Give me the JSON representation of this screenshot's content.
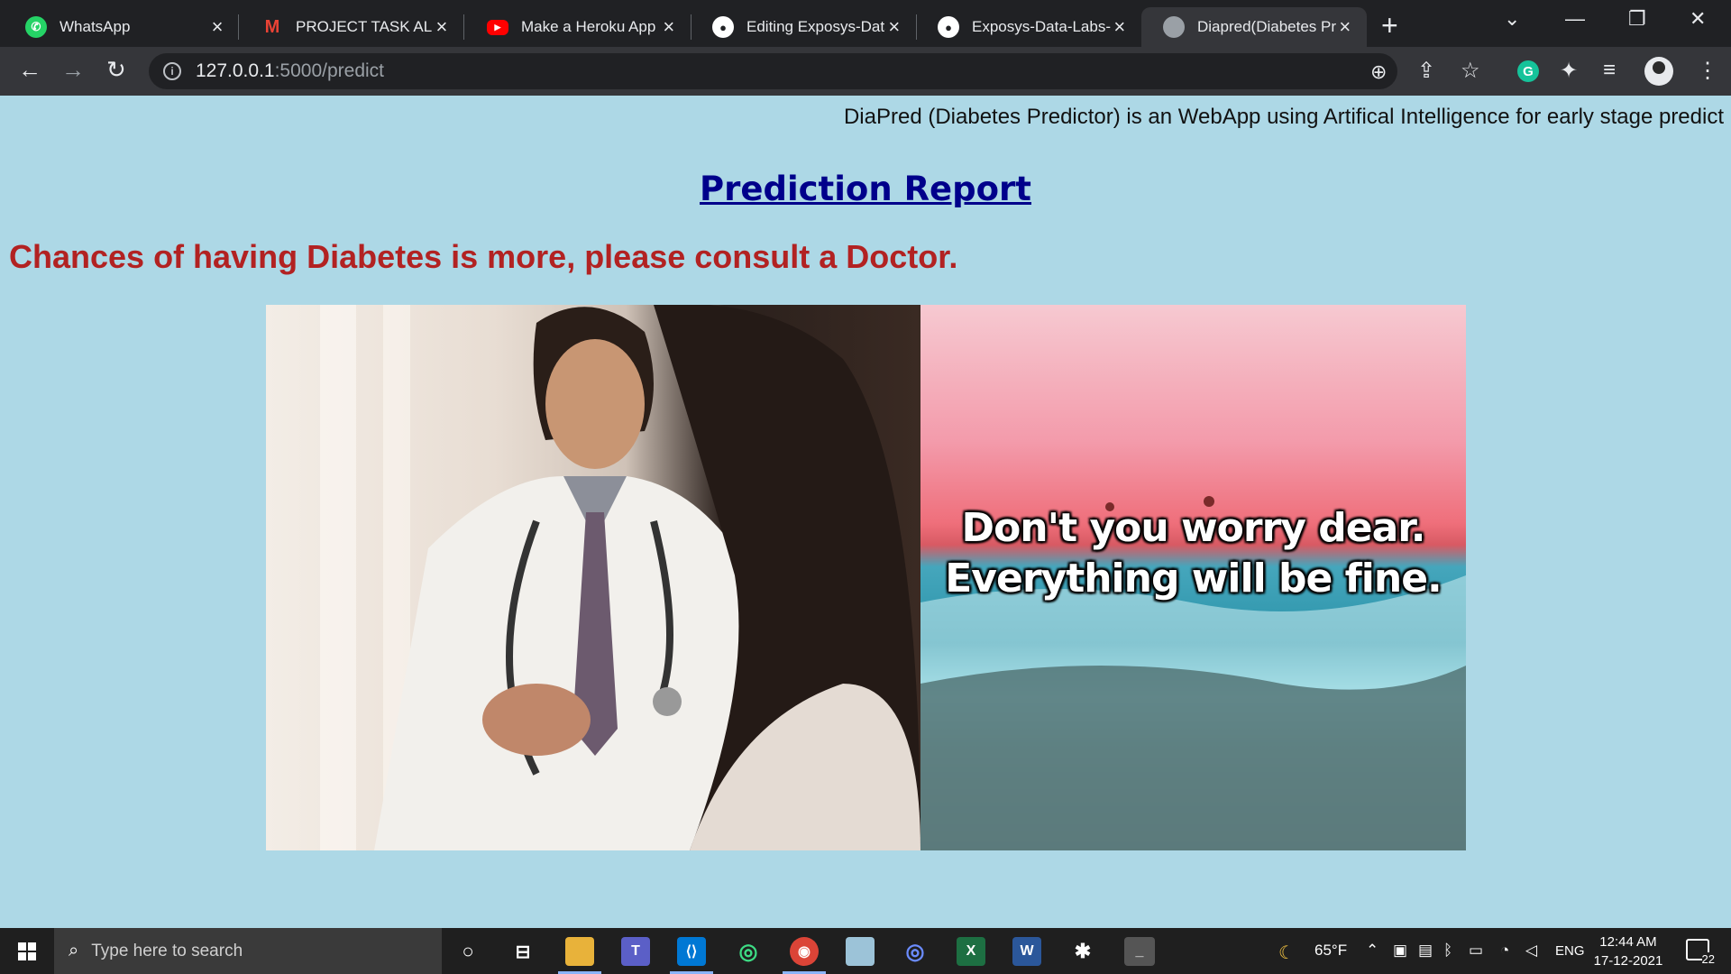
{
  "browser": {
    "tabs": [
      {
        "title": "WhatsApp",
        "icon": "whatsapp-icon",
        "active": false
      },
      {
        "title": "PROJECT TASK ALLOC",
        "icon": "gmail-icon",
        "active": false
      },
      {
        "title": "Make a Heroku App",
        "icon": "youtube-icon",
        "active": false
      },
      {
        "title": "Editing Exposys-Data",
        "icon": "github-icon",
        "active": false
      },
      {
        "title": "Exposys-Data-Labs-I",
        "icon": "github-icon",
        "active": false
      },
      {
        "title": "Diapred(Diabetes Pre",
        "icon": "globe-icon",
        "active": true
      }
    ],
    "url_host": "127.0.0.1",
    "url_rest": ":5000/predict"
  },
  "page": {
    "marquee": "DiaPred (Diabetes Predictor) is an WebApp using Artifical Intelligence for early stage predict",
    "title": "Prediction Report",
    "result": "Chances of having Diabetes is more, please consult a Doctor.",
    "beach_line1": "Don't you worry dear.",
    "beach_line2": "Everything will be fine."
  },
  "taskbar": {
    "search_placeholder": "Type here to search",
    "weather": "65°F",
    "language": "ENG",
    "time": "12:44 AM",
    "date": "17-12-2021",
    "notification_count": "22"
  },
  "colors": {
    "page_background": "#add8e6",
    "title": "#00008b",
    "result": "#b22222"
  }
}
